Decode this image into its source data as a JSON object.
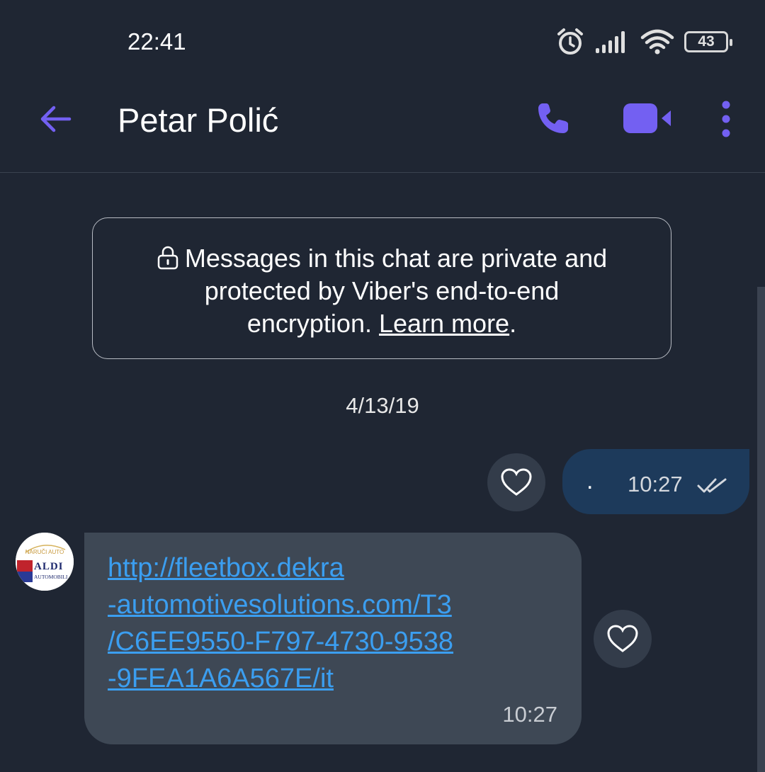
{
  "status_bar": {
    "time": "22:41",
    "battery": "43",
    "battery_level": 0.43,
    "icons": [
      "alarm-icon",
      "signal-icon",
      "wifi-icon",
      "battery-icon"
    ]
  },
  "header": {
    "contact_name": "Petar Polić",
    "icons": [
      "back-arrow-icon",
      "phone-icon",
      "video-camera-icon",
      "more-vertical-icon"
    ]
  },
  "encryption_notice": {
    "line1": "Messages in this chat are private and",
    "line2": "protected by Viber's end-to-end",
    "line3_prefix": "encryption. ",
    "link": "Learn more",
    "line3_suffix": "."
  },
  "date_separator": "4/13/19",
  "messages": [
    {
      "direction": "outgoing",
      "text": ".",
      "time": "10:27",
      "status": "delivered-double-check"
    },
    {
      "direction": "incoming",
      "avatar_text": {
        "top": "NARUČI AUTO",
        "brand": "ALDI",
        "bottom": "AUTOMOBILI"
      },
      "link_lines": [
        "http://fleetbox.dekra",
        "-automotivesolutions.com/T3",
        "/C6EE9550-F797-4730-9538",
        "-9FEA1A6A567E/it"
      ],
      "time": "10:27"
    }
  ],
  "colors": {
    "background": "#1f2633",
    "accent": "#7360f2",
    "outgoing_bubble": "#1d3a5b",
    "incoming_bubble": "#3e4855",
    "link": "#3b9ef0"
  }
}
